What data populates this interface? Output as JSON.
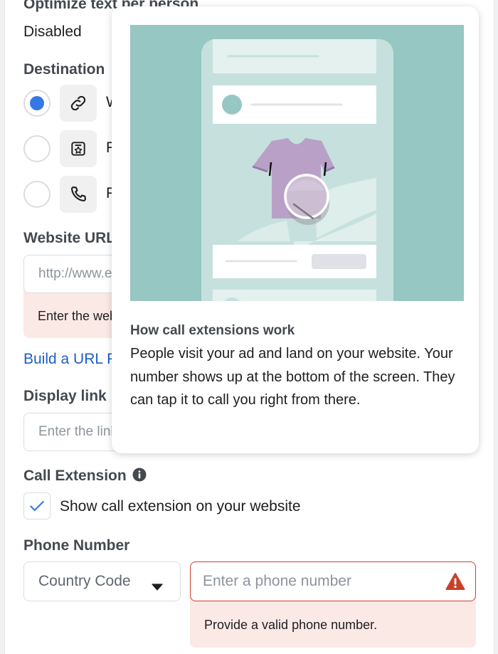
{
  "optimize": {
    "label": "Optimize text per person",
    "value": "Disabled"
  },
  "destination": {
    "label": "Destination",
    "options": [
      {
        "label": "Website",
        "icon": "link-icon",
        "selected": true
      },
      {
        "label": "Facebook Event",
        "icon": "event-star-icon",
        "selected": false
      },
      {
        "label": "Phone Call",
        "icon": "phone-icon",
        "selected": false
      }
    ]
  },
  "website_url": {
    "label": "Website URL",
    "placeholder": "http://www.example.com/page",
    "error": "Enter the website URL"
  },
  "build_url_link": "Build a URL Parameter",
  "display_link": {
    "label": "Display link",
    "placeholder": "Enter the link you want to show on your ad"
  },
  "call_extension": {
    "label": "Call Extension",
    "info_icon": "info-icon",
    "checkbox_label": "Show call extension on your website",
    "checked": true
  },
  "phone_number": {
    "label": "Phone Number",
    "country_code_placeholder": "Country Code",
    "phone_placeholder": "Enter a phone number",
    "error": "Provide a valid phone number.",
    "error_icon": "warning-icon"
  },
  "popover": {
    "title": "How call extensions work",
    "body": "People visit your ad and land on your website. Your number shows up at the bottom of the screen. They can tap it to call you right from there."
  },
  "colors": {
    "accent_blue": "#3578e5",
    "link_blue": "#1d5fc4",
    "error_red": "#c9402a",
    "error_bg": "#fbe9e6",
    "illustration_teal": "#96c7c2",
    "shirt_purple": "#b9a0c6"
  }
}
